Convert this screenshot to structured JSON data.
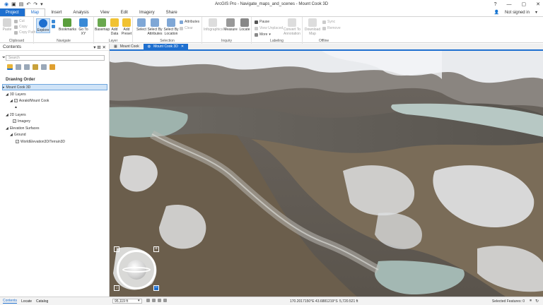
{
  "window": {
    "title": "ArcGIS Pro - Navigate_maps_and_scenes - Mount Cook 3D",
    "sign_in": "Not signed in",
    "help": "?"
  },
  "quick_access": [
    "save",
    "open",
    "undo",
    "redo"
  ],
  "tabs": [
    "Project",
    "Map",
    "Insert",
    "Analysis",
    "View",
    "Edit",
    "Imagery",
    "Share"
  ],
  "ribbon": {
    "clipboard": {
      "label": "Clipboard",
      "paste": "Paste",
      "cut": "Cut",
      "copy": "Copy",
      "copy_path": "Copy Path"
    },
    "navigate": {
      "label": "Navigate",
      "explore": "Explore",
      "bookmarks": "Bookmarks",
      "go_to_xy": "Go To XY"
    },
    "layer": {
      "label": "Layer",
      "basemap": "Basemap",
      "add_data": "Add Data",
      "add_preset": "Add Preset"
    },
    "selection": {
      "label": "Selection",
      "select": "Select",
      "select_by_attributes": "Select By Attributes",
      "select_by_location": "Select By Location",
      "attributes": "Attributes",
      "clear": "Clear"
    },
    "inquiry": {
      "label": "Inquiry",
      "infographics": "Infographics",
      "measure": "Measure",
      "locate": "Locate"
    },
    "labeling": {
      "label": "Labeling",
      "pause": "Pause",
      "view_unplaced": "View Unplaced",
      "more": "More",
      "convert": "Convert To Annotation"
    },
    "offline": {
      "label": "Offline",
      "download_map": "Download Map",
      "sync": "Sync",
      "remove": "Remove"
    }
  },
  "contents": {
    "title": "Contents",
    "search_placeholder": "Search",
    "drawing_order": "Drawing Order",
    "scene_name": "Mount Cook 3D",
    "layers_3d": "3D Layers",
    "layer_aoraki": "Aoraki/Mount Cook",
    "layers_2d": "2D Layers",
    "layer_imagery": "Imagery",
    "elevation_surfaces": "Elevation Surfaces",
    "ground": "Ground",
    "terrain": "WorldElevation3D/Terrain3D"
  },
  "doc_tabs": [
    "Mount Cook",
    "Mount Cook 3D"
  ],
  "bottom_tabs": [
    "Contents",
    "Locate",
    "Catalog"
  ],
  "status": {
    "scale": "95,119 ft",
    "coords": "170.2017150°E 43.6881219°S",
    "elevation": "5,720.521 ft",
    "selected": "Selected Features: 0"
  },
  "colors": {
    "accent": "#1e6fcf",
    "project_tab": "#1e6fcf"
  }
}
